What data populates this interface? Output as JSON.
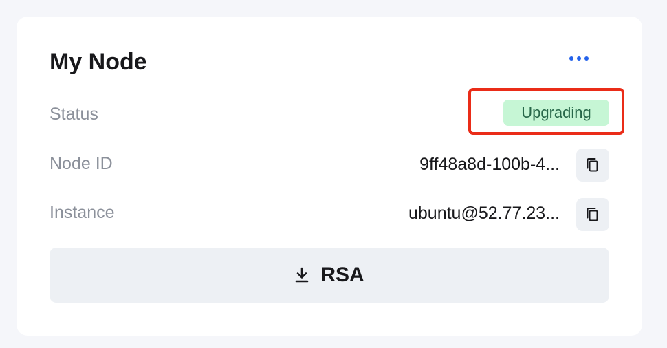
{
  "card": {
    "title": "My Node",
    "menu_icon": "more-horizontal-icon"
  },
  "rows": {
    "status": {
      "label": "Status",
      "value": "Upgrading"
    },
    "node_id": {
      "label": "Node ID",
      "value": "9ff48a8d-100b-4...",
      "action_icon": "copy-icon"
    },
    "instance": {
      "label": "Instance",
      "value": "ubuntu@52.77.23...",
      "action_icon": "copy-icon"
    }
  },
  "download_button": {
    "label": "RSA",
    "icon": "download-icon"
  },
  "colors": {
    "accent": "#2563eb",
    "badge_bg": "#c6f6d5",
    "badge_text": "#276749",
    "highlight": "#ea2c18",
    "button_bg": "#edf0f4"
  }
}
